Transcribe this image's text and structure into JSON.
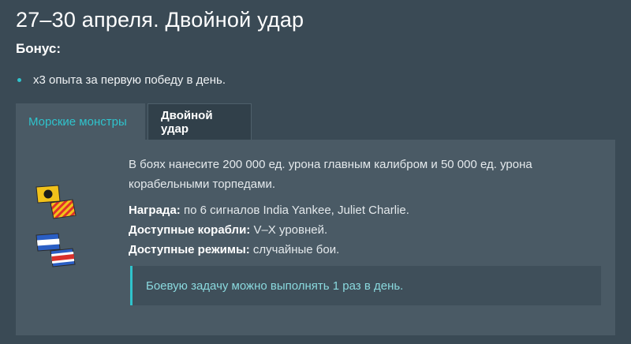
{
  "page": {
    "title": "27–30 апреля. Двойной удар",
    "bonus_heading": "Бонус:",
    "bonus_items": [
      "x3 опыта за первую победу в день."
    ]
  },
  "tabs": [
    {
      "label": "Морские монстры",
      "active": true
    },
    {
      "label": "Двойной удар",
      "active": false
    }
  ],
  "mission": {
    "description": "В боях нанесите 200 000 ед. урона главным калибром и 50 000 ед. урона корабельными торпедами.",
    "reward_label": "Награда:",
    "reward_value": " по 6 сигналов India Yankee, Juliet Charlie.",
    "ships_label": "Доступные корабли:",
    "ships_value": " V–X уровней.",
    "modes_label": "Доступные режимы:",
    "modes_value": " случайные бои.",
    "notice": "Боевую задачу можно выполнять 1 раз в день."
  },
  "flags": [
    {
      "icon": "flag-india-yankee-icon"
    },
    {
      "icon": "flag-juliet-charlie-icon"
    }
  ],
  "colors": {
    "background": "#3a4a55",
    "panel": "#4a5a65",
    "accent": "#2fc3cc"
  }
}
